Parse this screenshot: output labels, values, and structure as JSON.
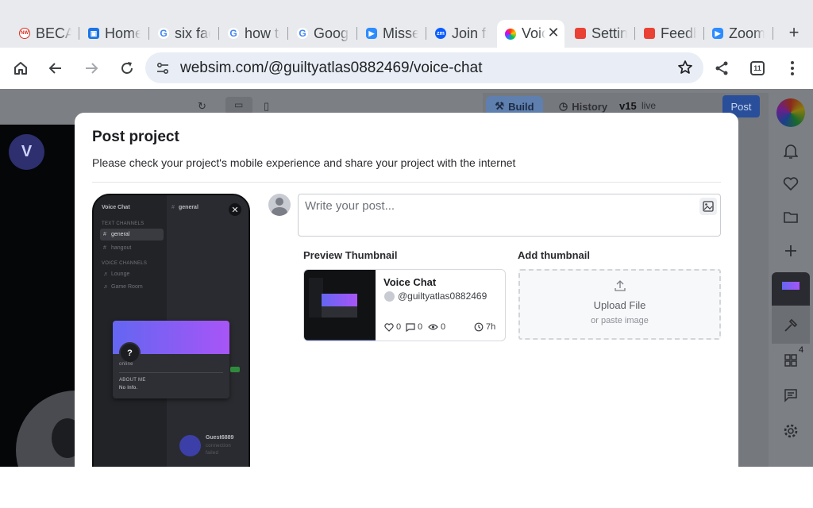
{
  "browser": {
    "tabs": [
      {
        "label": "BECAUSE",
        "favicon": "becau-favicon",
        "color": "#d93025"
      },
      {
        "label": "Home",
        "favicon": "home-favicon",
        "color": "#1a73e8"
      },
      {
        "label": "six facts",
        "favicon": "google-favicon",
        "color": "#4285f4"
      },
      {
        "label": "how to",
        "favicon": "google-favicon",
        "color": "#4285f4"
      },
      {
        "label": "Google",
        "favicon": "google-favicon",
        "color": "#4285f4"
      },
      {
        "label": "Missed",
        "favicon": "zoom-video-favicon",
        "color": "#2d8cff"
      },
      {
        "label": "Join from",
        "favicon": "zoom-favicon",
        "color": "#0b5cff"
      },
      {
        "label": "Voice Chat",
        "favicon": "websim-favicon",
        "color": "#ff8a00",
        "active": true
      },
      {
        "label": "Settings",
        "favicon": "websim-red-favicon",
        "color": "#e94235"
      },
      {
        "label": "Feedback",
        "favicon": "websim-red-favicon",
        "color": "#e94235"
      },
      {
        "label": "Zoom",
        "favicon": "zoom-video-favicon",
        "color": "#2d8cff"
      }
    ],
    "url": "websim.com/@guiltyatlas0882469/voice-chat",
    "tab_count": "11"
  },
  "page": {
    "avatar_letter": "V",
    "build_label": "Build",
    "history_label": "History",
    "version": "v15",
    "live_label": "live",
    "post_label": "Post",
    "sidebar_badge": "4"
  },
  "modal": {
    "title": "Post project",
    "subtitle": "Please check your project's mobile experience and share your project with the internet",
    "post_placeholder": "Write your post...",
    "preview_label": "Preview Thumbnail",
    "add_thumb_label": "Add thumbnail",
    "upload_title": "Upload File",
    "upload_sub": "or paste image",
    "card": {
      "title": "Voice Chat",
      "user": "@guiltyatlas0882469",
      "likes": "0",
      "comments": "0",
      "views": "0",
      "age": "7h"
    },
    "phone": {
      "app_title": "Voice Chat",
      "channel": "general",
      "text_channels": "TEXT CHANNELS",
      "chan1": "general",
      "chan2": "hangout",
      "voice_channels": "VOICE CHANNELS",
      "voice1": "Lounge",
      "voice2": "Game Room",
      "status": "online",
      "about_me": "ABOUT ME",
      "about_text": "No Info.",
      "guest": "Guest6889",
      "guest_status": "connection",
      "guest_status2": "failed"
    }
  }
}
